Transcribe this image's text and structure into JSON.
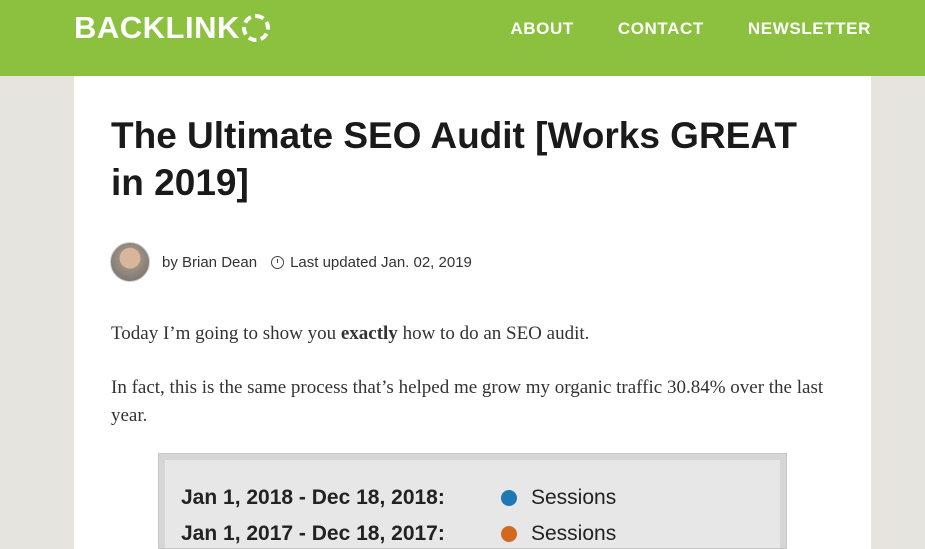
{
  "header": {
    "logo_text": "BACKLINK",
    "nav": [
      {
        "label": "ABOUT"
      },
      {
        "label": "CONTACT"
      },
      {
        "label": "NEWSLETTER"
      }
    ],
    "bg_color": "#8cc13f"
  },
  "article": {
    "title": "The Ultimate SEO Audit [Works GREAT in 2019]",
    "author": "by Brian Dean",
    "updated": "Last updated Jan. 02, 2019",
    "p1_before": "Today I’m going to show you ",
    "p1_bold": "exactly",
    "p1_after": " how to do an SEO audit.",
    "p2": "In fact, this is the same process that’s helped me grow my organic traffic 30.84% over the last year."
  },
  "chart": {
    "rows": [
      {
        "range": "Jan 1, 2018 - Dec 18, 2018:",
        "metric": "Sessions",
        "color": "#1f77b4"
      },
      {
        "range": "Jan 1, 2017 - Dec 18, 2017:",
        "metric": "Sessions",
        "color": "#d2691e"
      }
    ]
  }
}
